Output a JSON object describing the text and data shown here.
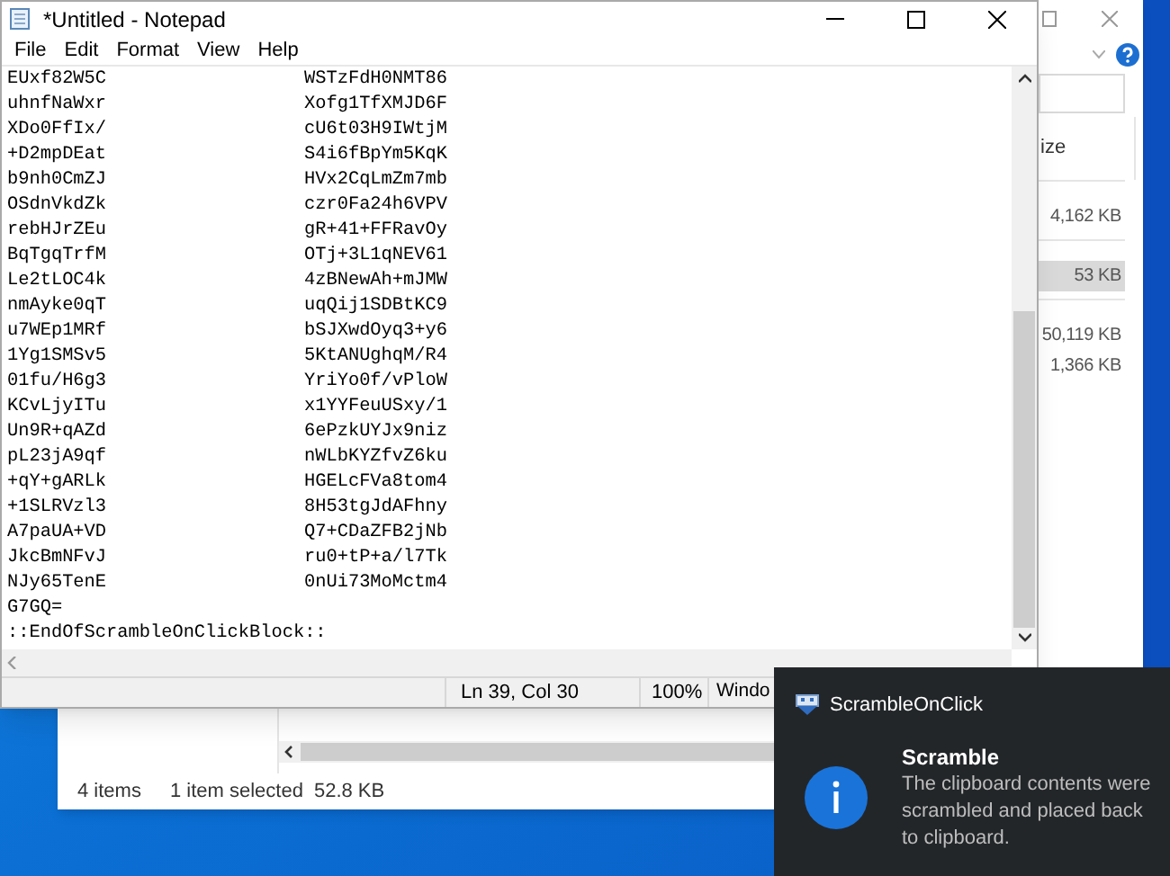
{
  "notepad": {
    "title": "*Untitled - Notepad",
    "menu": [
      "File",
      "Edit",
      "Format",
      "View",
      "Help"
    ],
    "lines": [
      {
        "left": "EUxf82W5C",
        "right": "WSTzFdH0NMT86"
      },
      {
        "left": "uhnfNaWxr",
        "right": "Xofg1TfXMJD6F"
      },
      {
        "left": "XDo0FfIx/",
        "right": "cU6t03H9IWtjM"
      },
      {
        "left": "+D2mpDEat",
        "right": "S4i6fBpYm5KqK"
      },
      {
        "left": "b9nh0CmZJ",
        "right": "HVx2CqLmZm7mb"
      },
      {
        "left": "OSdnVkdZk",
        "right": "czr0Fa24h6VPV"
      },
      {
        "left": "rebHJrZEu",
        "right": "gR+41+FFRavOy"
      },
      {
        "left": "BqTgqTrfM",
        "right": "OTj+3L1qNEV61"
      },
      {
        "left": "Le2tLOC4k",
        "right": "4zBNewAh+mJMW"
      },
      {
        "left": "nmAyke0qT",
        "right": "uqQij1SDBtKC9"
      },
      {
        "left": "u7WEp1MRf",
        "right": "bSJXwdOyq3+y6"
      },
      {
        "left": "1Yg1SMSv5",
        "right": "5KtANUghqM/R4"
      },
      {
        "left": "01fu/H6g3",
        "right": "YriYo0f/vPloW"
      },
      {
        "left": "KCvLjyITu",
        "right": "x1YYFeuUSxy/1"
      },
      {
        "left": "Un9R+qAZd",
        "right": "6ePzkUYJx9niz"
      },
      {
        "left": "pL23jA9qf",
        "right": "nWLbKYZfvZ6ku"
      },
      {
        "left": "+qY+gARLk",
        "right": "HGELcFVa8tom4"
      },
      {
        "left": "+1SLRVzl3",
        "right": "8H53tgJdAFhny"
      },
      {
        "left": "A7paUA+VD",
        "right": "Q7+CDaZFB2jNb"
      },
      {
        "left": "JkcBmNFvJ",
        "right": "ru0+tP+a/l7Tk"
      },
      {
        "left": "NJy65TenE",
        "right": "0nUi73MoMctm4"
      }
    ],
    "tail_lines": [
      "G7GQ=",
      "::EndOfScrambleOnClickBlock::"
    ],
    "status": {
      "position": "Ln 39, Col 30",
      "zoom": "100%",
      "line_ending": "Windo"
    }
  },
  "explorer": {
    "column_header": "ize",
    "groups": [
      {
        "items": [
          {
            "text": "4,162 KB",
            "selected": false
          }
        ]
      },
      {
        "items": [
          {
            "text": "53 KB",
            "selected": true
          }
        ]
      },
      {
        "items": [
          {
            "text": "50,119 KB",
            "selected": false
          },
          {
            "text": "1,366 KB",
            "selected": false
          }
        ]
      }
    ],
    "status": {
      "items": "4 items",
      "selection": "1 item selected",
      "selection_size": "52.8 KB"
    }
  },
  "notification": {
    "app": "ScrambleOnClick",
    "title": "Scramble",
    "message": "The clipboard contents were scrambled and placed back to clipboard."
  }
}
